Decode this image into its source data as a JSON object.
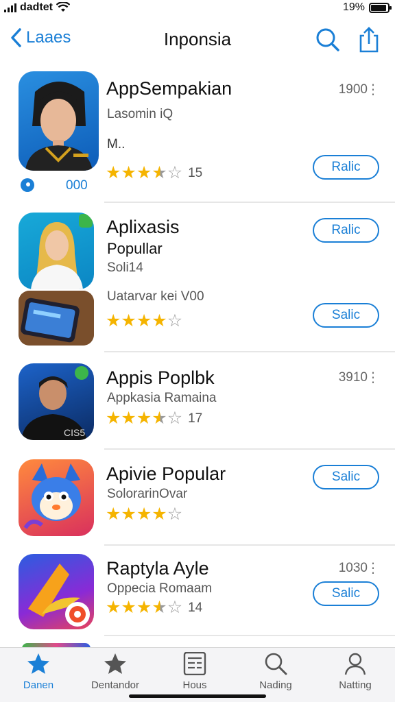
{
  "status_bar": {
    "carrier": "dadtet",
    "battery": "19%",
    "battery_level": 0.8
  },
  "nav": {
    "back_label": "Laaes",
    "title": "Inponsia"
  },
  "apps": [
    {
      "name": "AppSempakian",
      "sub": "Lasomin iQ",
      "sub2": "M..",
      "count": "1900",
      "stars": 3.5,
      "rating_count": "15",
      "button": "Ralic",
      "badge": "000"
    },
    {
      "name": "Aplixasis",
      "sub2": "Popullar",
      "sub": "Soli14",
      "tagline": "Uatarvar kei V00",
      "stars": 4,
      "button_top": "Ralic",
      "button": "Salic"
    },
    {
      "name": "Appis Poplbk",
      "sub": "Appkasia Ramaina",
      "count": "3910",
      "stars": 3.5,
      "rating_count": "17",
      "icon_text": "CIS5"
    },
    {
      "name": "Apivie Popular",
      "sub": "SolorarinOvar",
      "stars": 4,
      "button": "Salic"
    },
    {
      "name": "Raptyla Ayle",
      "sub": "Oppecia Romaam",
      "count": "1030",
      "stars": 3.5,
      "rating_count": "14",
      "button": "Salic"
    }
  ],
  "tabs": [
    {
      "label": "Danen",
      "icon": "star-icon"
    },
    {
      "label": "Dentandor",
      "icon": "favorite-icon"
    },
    {
      "label": "Hous",
      "icon": "list-icon"
    },
    {
      "label": "Nading",
      "icon": "search-icon"
    },
    {
      "label": "Natting",
      "icon": "person-icon"
    }
  ],
  "colors": {
    "accent": "#1a7fd6",
    "star": "#f5b400"
  }
}
